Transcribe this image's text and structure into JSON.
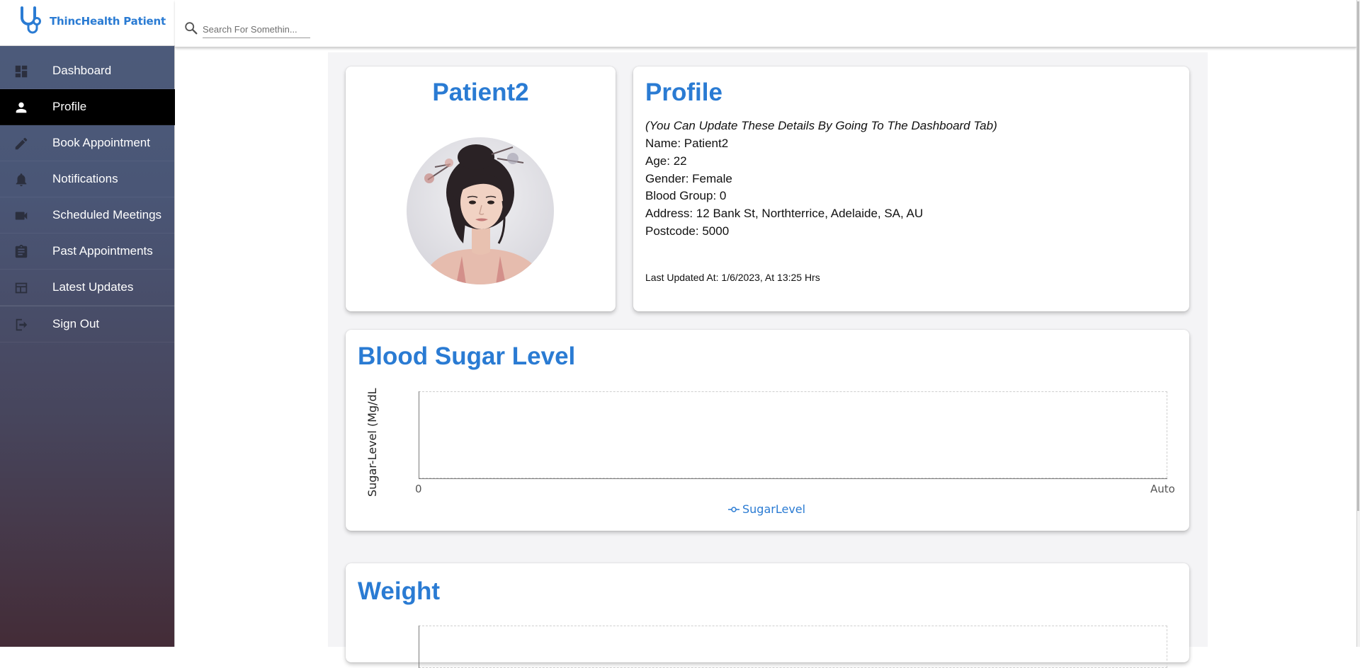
{
  "brand": {
    "name": "ThincHealth Patient",
    "logo_icon": "stethoscope-logo-icon",
    "color": "#2a7bd3"
  },
  "search": {
    "placeholder": "Search For Somethin...",
    "icon": "search-icon"
  },
  "sidebar": {
    "active": "Profile",
    "items": [
      {
        "label": "Dashboard",
        "icon": "dashboard-icon"
      },
      {
        "label": "Profile",
        "icon": "person-icon"
      },
      {
        "label": "Book Appointment",
        "icon": "pencil-icon"
      },
      {
        "label": "Notifications",
        "icon": "bell-icon"
      },
      {
        "label": "Scheduled Meetings",
        "icon": "video-camera-icon"
      },
      {
        "label": "Past Appointments",
        "icon": "clipboard-icon"
      },
      {
        "label": "Latest Updates",
        "icon": "table-icon"
      },
      {
        "label": "Sign Out",
        "icon": "sign-out-icon"
      }
    ]
  },
  "patient_card": {
    "name": "Patient2",
    "avatar_icon": "patient-photo"
  },
  "profile": {
    "title": "Profile",
    "note": "(You Can Update These Details By Going To The Dashboard Tab)",
    "lines": [
      "Name: Patient2",
      "Age: 22",
      "Gender: Female",
      "Blood Group: 0",
      "Address: 12 Bank St, Northterrice, Adelaide, SA, AU",
      "Postcode: 5000"
    ],
    "last_updated": "Last Updated At: 1/6/2023, At 13:25 Hrs"
  },
  "chart_data": [
    {
      "type": "line",
      "title": "Blood Sugar Level",
      "ylabel": "Sugar-Level (Mg/dL",
      "xlabel": "",
      "x_tick_labels": [
        "0",
        "Auto"
      ],
      "series": [
        {
          "name": "SugarLevel",
          "values": []
        }
      ],
      "legend": "bottom-center",
      "grid": false,
      "color": "#2a7bd3"
    },
    {
      "type": "line",
      "title": "Weight",
      "series": [],
      "color": "#2a7bd3"
    }
  ]
}
